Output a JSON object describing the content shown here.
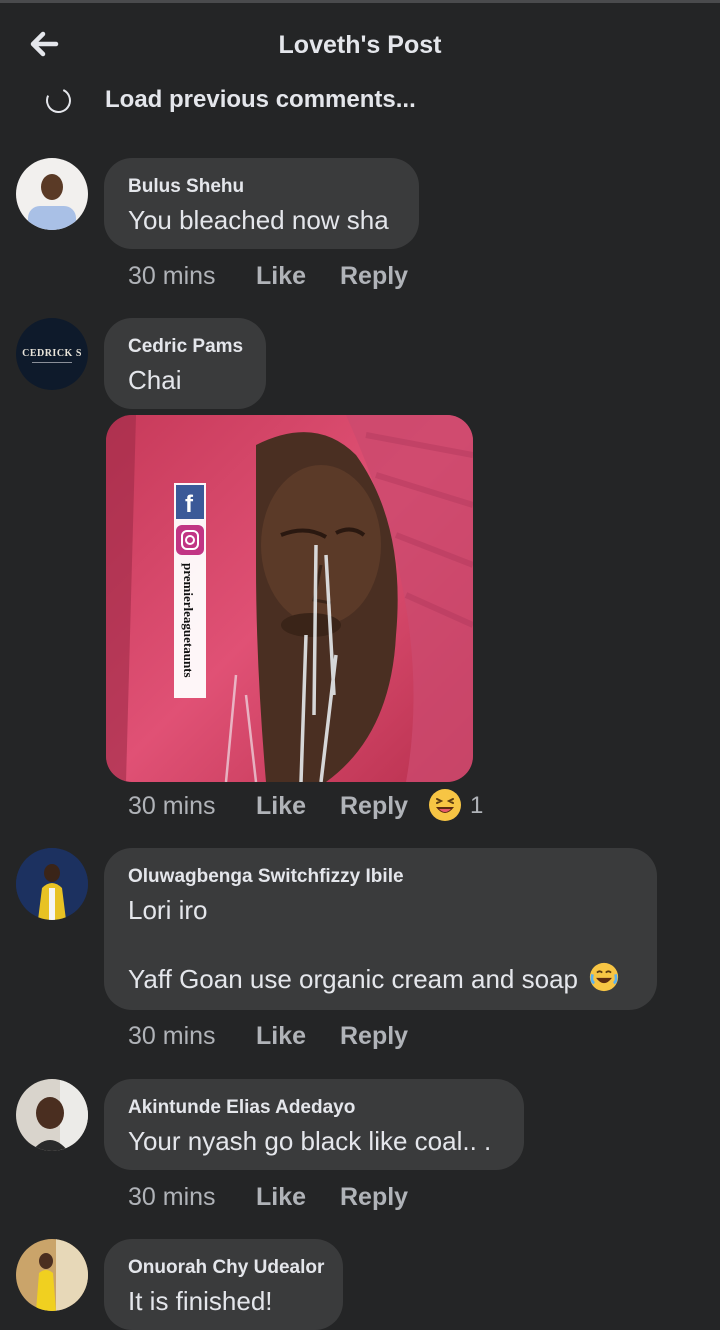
{
  "header": {
    "title": "Loveth's Post"
  },
  "load_previous": {
    "label": "Load previous comments..."
  },
  "comments": [
    {
      "author": "Bulus Shehu",
      "text": "You bleached now sha",
      "time": "30 mins",
      "like": "Like",
      "reply": "Reply"
    },
    {
      "author": "Cedric Pams",
      "text": "Chai",
      "avatar_text": "CEDRICK S",
      "time": "30 mins",
      "like": "Like",
      "reply": "Reply",
      "reaction_count": "1",
      "photo_watermark": "premierleaguetaunts"
    },
    {
      "author": "Oluwagbenga Switchfizzy Ibile",
      "text_line1": "Lori iro",
      "text_line2": "Yaff Goan use organic cream and soap",
      "time": "30 mins",
      "like": "Like",
      "reply": "Reply"
    },
    {
      "author": "Akintunde Elias Adedayo",
      "text": "Your nyash go black like coal.. .",
      "time": "30 mins",
      "like": "Like",
      "reply": "Reply"
    },
    {
      "author": "Onuorah Chy Udealor",
      "text": "It is finished!"
    }
  ],
  "colors": {
    "background": "#242526",
    "bubble": "#3a3b3c",
    "text": "#e4e6eb",
    "secondary": "#b0b3b8",
    "photo_cloth": "#d8456a"
  }
}
